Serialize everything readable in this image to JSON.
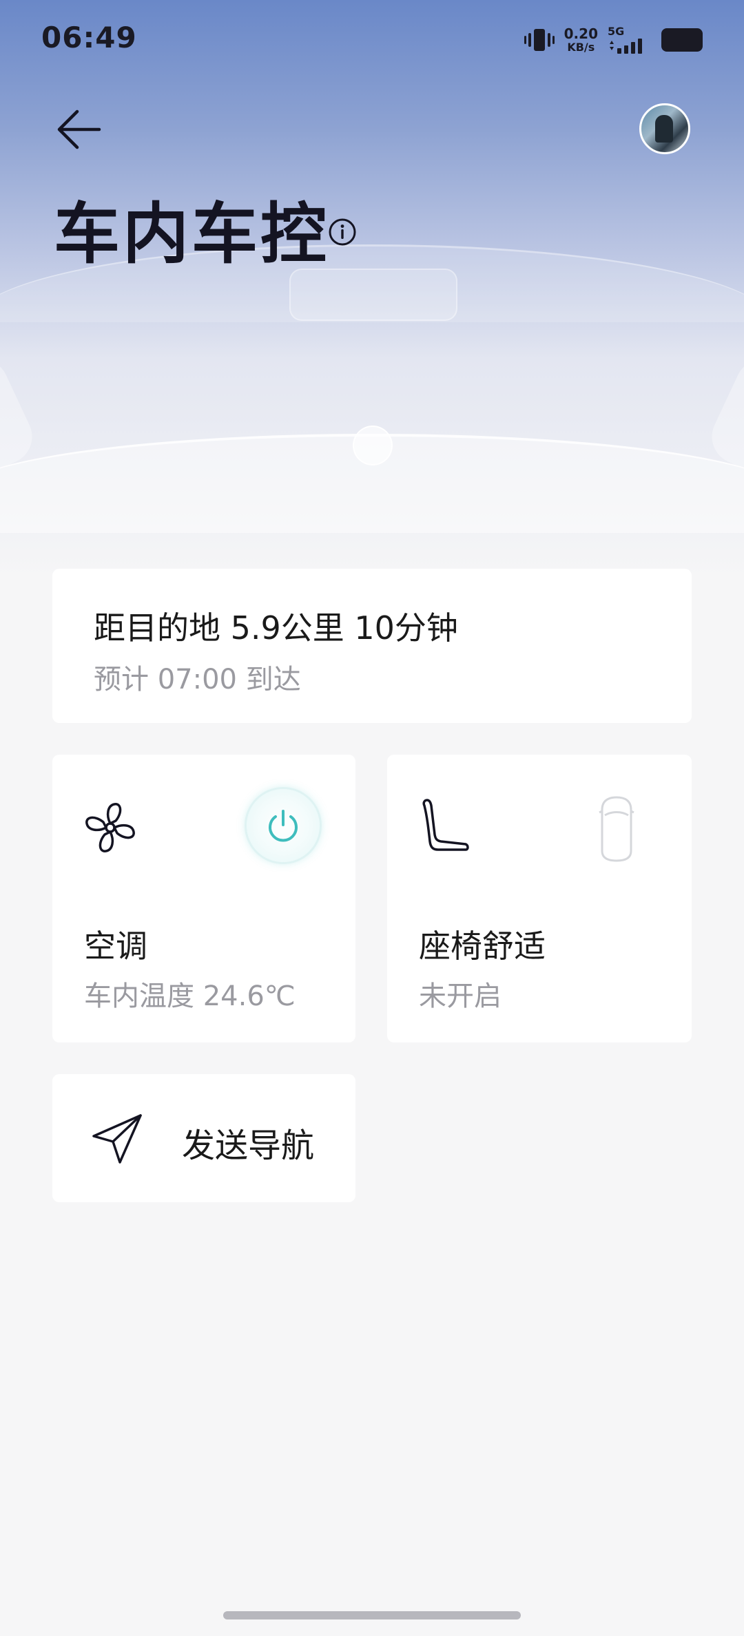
{
  "status_bar": {
    "time": "06:49",
    "net_speed_value": "0.20",
    "net_speed_unit": "KB/s",
    "network_type": "5G",
    "icons": [
      "vibrate-icon",
      "signal-icon",
      "battery-icon"
    ]
  },
  "header": {
    "back_icon": "arrow-left-icon",
    "title": "车内车控",
    "info_icon": "info-icon",
    "avatar": "user-avatar"
  },
  "destination_card": {
    "main_text": "距目的地 5.9公里 10分钟",
    "sub_text": "预计 07:00 到达"
  },
  "ac_card": {
    "icon": "fan-icon",
    "power_icon": "power-icon",
    "power_state": "on",
    "label": "空调",
    "status": "车内温度 24.6℃"
  },
  "seat_card": {
    "icon": "seat-icon",
    "car_icon": "car-top-icon",
    "label": "座椅舒适",
    "status": "未开启"
  },
  "nav_card": {
    "icon": "send-navigation-icon",
    "label": "发送导航"
  },
  "colors": {
    "accent_teal": "#3fbdbd",
    "hero_top": "#6a88c8",
    "background": "#f6f6f7",
    "card": "#ffffff",
    "secondary_text": "#9a9aa0"
  }
}
